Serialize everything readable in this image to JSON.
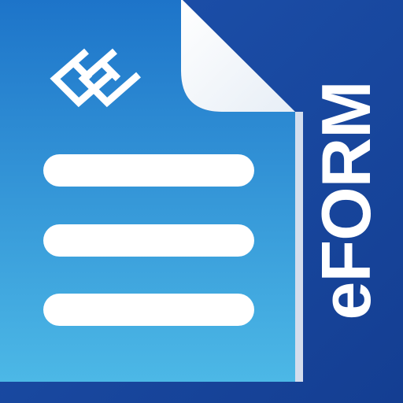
{
  "app_icon": {
    "brand_text": "eFORM",
    "logo_icon": "double-e-monogram-icon",
    "document_icon": "document-page-icon",
    "line_count": 3,
    "colors": {
      "panel_blue": "#17439b",
      "panel_blue_light": "#1f54b0",
      "page_top": "#1f78cc",
      "page_bottom": "#48b5e4",
      "page_fold": "#ffffff",
      "foreground": "#ffffff"
    }
  }
}
